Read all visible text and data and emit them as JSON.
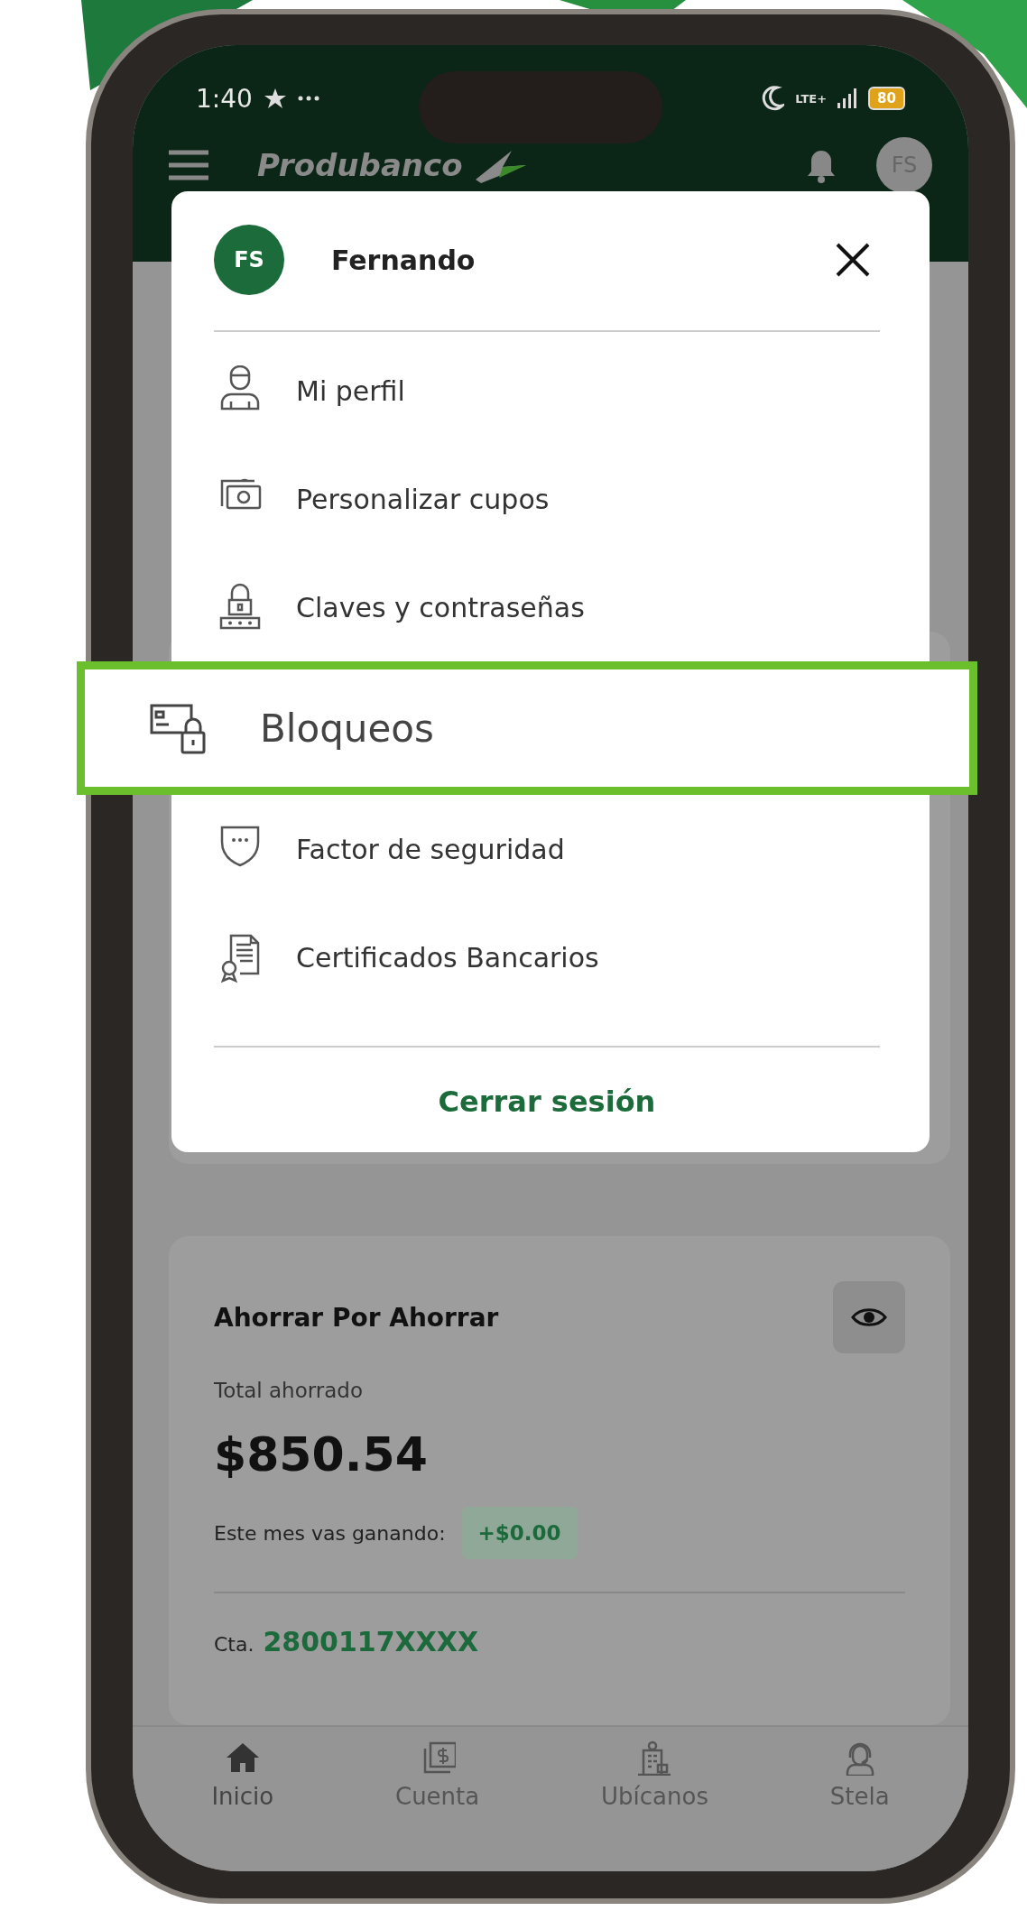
{
  "status_bar": {
    "time": "1:40",
    "network": "LTE+",
    "battery": "80"
  },
  "header": {
    "logo": "Produbanco",
    "avatar": "FS"
  },
  "menu": {
    "avatar": "FS",
    "name": "Fernando",
    "items": [
      {
        "label": "Mi perfil",
        "highlighted": false
      },
      {
        "label": "Personalizar cupos",
        "highlighted": false
      },
      {
        "label": "Claves y contraseñas",
        "highlighted": false
      },
      {
        "label": "Bloqueos",
        "highlighted": true
      },
      {
        "label": "Factor de seguridad",
        "highlighted": false
      },
      {
        "label": "Certificados Bancarios",
        "highlighted": false
      }
    ],
    "logout": "Cerrar sesión"
  },
  "savings_card": {
    "title": "Ahorrar Por Ahorrar",
    "total_label": "Total ahorrado",
    "amount": "$850.54",
    "month_label": "Este mes vas ganando:",
    "month_gain": "+$0.00",
    "account_label": "Cta.",
    "account_number": "2800117XXXX"
  },
  "bottom_nav": [
    {
      "label": "Inicio",
      "selected": true
    },
    {
      "label": "Cuenta",
      "selected": false
    },
    {
      "label": "Ubícanos",
      "selected": false
    },
    {
      "label": "Stela",
      "selected": false
    }
  ]
}
